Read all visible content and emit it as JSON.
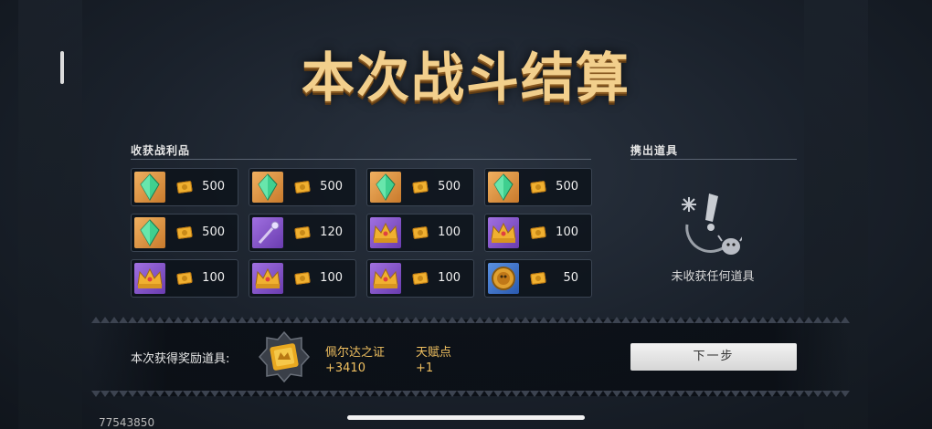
{
  "title": "本次战斗结算",
  "loot_section": {
    "label": "收获战利品"
  },
  "dropped_section": {
    "label": "携出道具",
    "empty_text": "未收获任何道具"
  },
  "loot_items": [
    {
      "icon": "green-crystal-icon",
      "bg": "orange",
      "count": "500"
    },
    {
      "icon": "green-crystal-icon",
      "bg": "orange",
      "count": "500"
    },
    {
      "icon": "green-crystal-icon",
      "bg": "orange",
      "count": "500"
    },
    {
      "icon": "green-crystal-icon",
      "bg": "orange",
      "count": "500"
    },
    {
      "icon": "green-crystal-icon",
      "bg": "orange",
      "count": "500"
    },
    {
      "icon": "scepter-icon",
      "bg": "purple",
      "count": "120"
    },
    {
      "icon": "crown-icon",
      "bg": "purple",
      "count": "100"
    },
    {
      "icon": "crown-icon",
      "bg": "purple",
      "count": "100"
    },
    {
      "icon": "crown-icon",
      "bg": "purple",
      "count": "100"
    },
    {
      "icon": "crown-icon",
      "bg": "purple",
      "count": "100"
    },
    {
      "icon": "crown-icon",
      "bg": "purple",
      "count": "100"
    },
    {
      "icon": "gold-coin-icon",
      "bg": "blue",
      "count": "50"
    }
  ],
  "rewards": {
    "label": "本次获得奖励道具:",
    "items": [
      {
        "name": "佩尔达之证",
        "value": "+3410"
      },
      {
        "name": "天赋点",
        "value": "+1"
      }
    ]
  },
  "next_button": "下一步",
  "uid": "77543850",
  "colors": {
    "accent_gold": "#f0c060",
    "title_gold": "#f2cf8c"
  }
}
